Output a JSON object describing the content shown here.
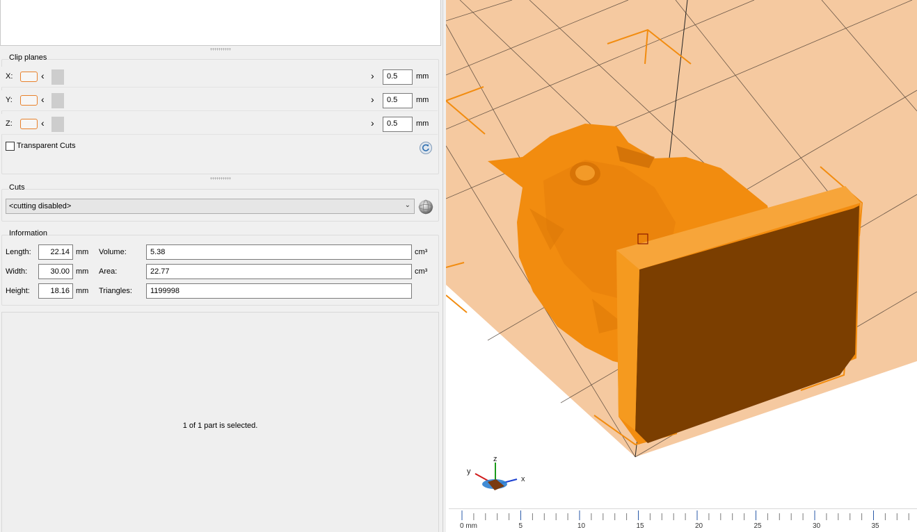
{
  "clip_planes": {
    "title": "Clip planes",
    "unit": "mm",
    "rows": [
      {
        "axis": "X:",
        "value": "0.5"
      },
      {
        "axis": "Y:",
        "value": "0.5"
      },
      {
        "axis": "Z:",
        "value": "0.5"
      }
    ],
    "arrow_left": "‹",
    "arrow_right": "›",
    "transparent_cuts_label": "Transparent Cuts",
    "transparent_cuts_checked": false
  },
  "cuts": {
    "title": "Cuts",
    "selected": "<cutting disabled>"
  },
  "information": {
    "title": "Information",
    "length_label": "Length:",
    "length_value": "22.14",
    "length_unit": "mm",
    "width_label": "Width:",
    "width_value": "30.00",
    "width_unit": "mm",
    "height_label": "Height:",
    "height_value": "18.16",
    "height_unit": "mm",
    "volume_label": "Volume:",
    "volume_value": "5.38",
    "volume_unit": "cm³",
    "area_label": "Area:",
    "area_value": "22.77",
    "area_unit": "cm³",
    "triangles_label": "Triangles:",
    "triangles_value": "1199998"
  },
  "parts": {
    "status": "1 of 1 part is selected."
  },
  "viewport": {
    "axis_x": "x",
    "axis_y": "y",
    "axis_z": "z",
    "model_color": "#f28c0f",
    "plate_color": "#f5c9a0",
    "ruler_labels": [
      "0 mm",
      "5",
      "10",
      "15",
      "20",
      "25",
      "30",
      "35"
    ]
  },
  "icons": {
    "reset": "reset-icon",
    "sphere": "sphere-icon",
    "dropdown": "chevron-down-icon"
  }
}
